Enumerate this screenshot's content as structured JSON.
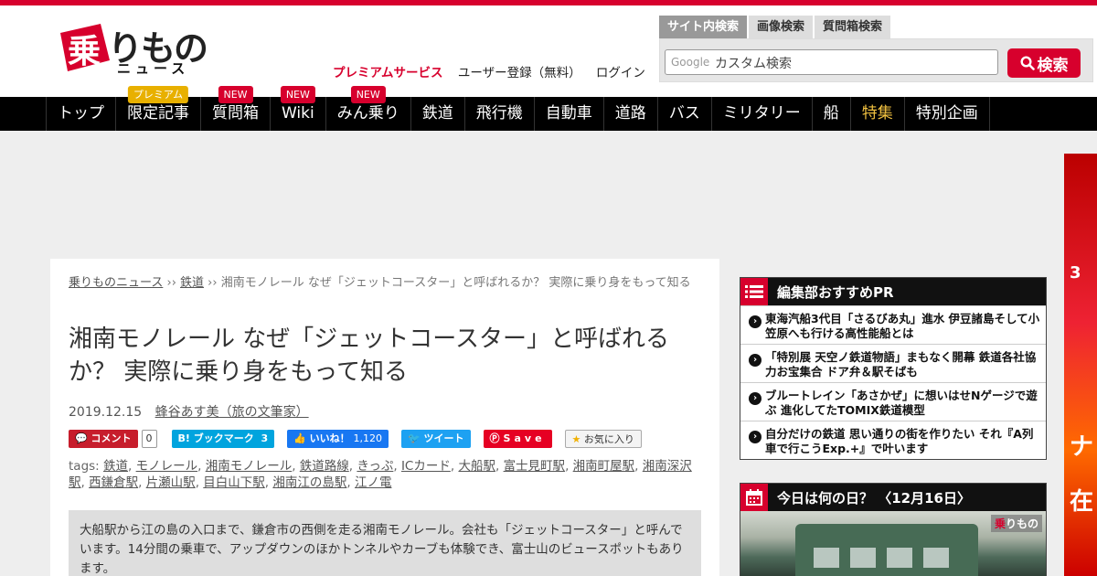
{
  "header": {
    "logo_badge": "乗",
    "logo_text": "りもの",
    "logo_sub": "ニュース",
    "links": [
      "プレミアムサービス",
      "ユーザー登録（無料）",
      "ログイン"
    ],
    "search_tabs": [
      "サイト内検索",
      "画像検索",
      "質問箱検索"
    ],
    "search_google": "Google",
    "search_placeholder": "カスタム検索",
    "search_button": "検索"
  },
  "nav": [
    {
      "label": "トップ",
      "flag": ""
    },
    {
      "label": "限定記事",
      "flag": "プレミアム"
    },
    {
      "label": "質問箱",
      "flag": "NEW"
    },
    {
      "label": "Wiki",
      "flag": "NEW"
    },
    {
      "label": "みん乗り",
      "flag": "NEW"
    },
    {
      "label": "鉄道",
      "flag": ""
    },
    {
      "label": "飛行機",
      "flag": ""
    },
    {
      "label": "自動車",
      "flag": ""
    },
    {
      "label": "道路",
      "flag": ""
    },
    {
      "label": "バス",
      "flag": ""
    },
    {
      "label": "ミリタリー",
      "flag": ""
    },
    {
      "label": "船",
      "flag": ""
    },
    {
      "label": "特集",
      "flag": ""
    },
    {
      "label": "特別企画",
      "flag": ""
    }
  ],
  "article": {
    "breadcrumb": [
      "乗りものニュース",
      "鉄道",
      "湘南モノレール なぜ「ジェットコースター」と呼ばれるか？ 実際に乗り身をもって知る"
    ],
    "title": "湘南モノレール なぜ「ジェットコースター」と呼ばれるか？ 実際に乗り身をもって知る",
    "date": "2019.12.15",
    "author": "蜂谷あす美（旅の文筆家）",
    "share": {
      "comment": "コメント",
      "comment_count": "0",
      "hatena": "B! ブックマーク",
      "hatena_count": "3",
      "like": "いいね！",
      "like_count": "1,120",
      "tweet": "ツイート",
      "save": "Save",
      "favorite": "お気に入り"
    },
    "tags_label": "tags:",
    "tags": [
      "鉄道",
      "モノレール",
      "湘南モノレール",
      "鉄道路線",
      "きっぷ",
      "ICカード",
      "大船駅",
      "富士見町駅",
      "湘南町屋駅",
      "湘南深沢駅",
      "西鎌倉駅",
      "片瀬山駅",
      "目白山下駅",
      "湘南江の島駅",
      "江ノ電"
    ],
    "summary": "大船駅から江の島の入口まで、鎌倉市の西側を走る湘南モノレール。会社も「ジェットコースター」と呼んでいます。14分間の乗車で、アップダウンのほかトンネルやカーブも体験でき、富士山のビュースポットもあります。"
  },
  "sidebar": {
    "pr_title": "編集部おすすめPR",
    "pr_items": [
      "東海汽船3代目「さるびあ丸」進水 伊豆諸島そして小笠原へも行ける高性能船とは",
      "「特別展 天空ノ鉄道物語」まもなく開幕 鉄道各社協力お宝集合 ドア弁＆駅そばも",
      "ブルートレイン「あさかぜ」に想いはせNゲージで遊ぶ 進化してたTOMIX鉄道模型",
      "自分だけの鉄道 思い通りの街を作りたい それ『A列車で行こうExp.+』で叶います"
    ],
    "today_title": "今日は何の日？ 〈12月16日〉",
    "today_watermark_a": "乗",
    "today_watermark_b": "りもの"
  },
  "colors": {
    "brand": "#d7002d",
    "nav_bg": "#000000",
    "special": "#f0c040"
  }
}
